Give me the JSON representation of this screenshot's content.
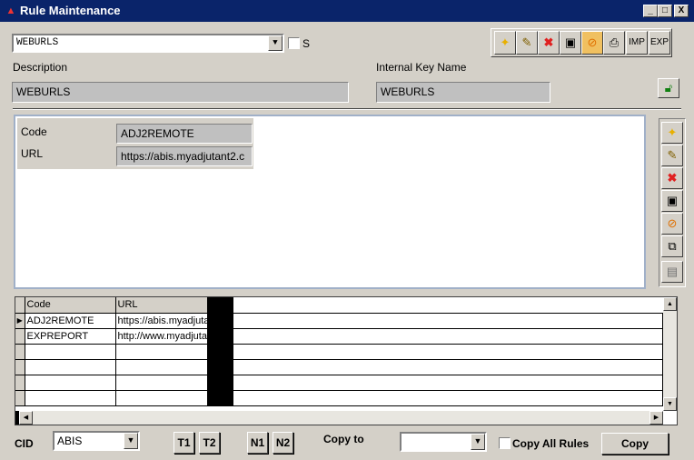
{
  "window": {
    "title": "Rule Maintenance",
    "minimize": "_",
    "maximize": "□",
    "close": "X"
  },
  "header": {
    "rule_select_value": "WEBURLS",
    "s_checkbox_label": "S",
    "description_label": "Description",
    "description_value": "WEBURLS",
    "internal_key_label": "Internal Key Name",
    "internal_key_value": "WEBURLS"
  },
  "toolbar": {
    "imp_label": "IMP",
    "exp_label": "EXP"
  },
  "detail": {
    "code_label": "Code",
    "code_value": "ADJ2REMOTE",
    "url_label": "URL",
    "url_value": "https://abis.myadjutant2.c"
  },
  "grid": {
    "columns": [
      "Code",
      "URL"
    ],
    "rows": [
      {
        "code": "ADJ2REMOTE",
        "url": "https://abis.myadjuta"
      },
      {
        "code": "EXPREPORT",
        "url": "http://www.myadjuta"
      },
      {
        "code": "",
        "url": ""
      },
      {
        "code": "",
        "url": ""
      },
      {
        "code": "",
        "url": ""
      },
      {
        "code": "",
        "url": ""
      }
    ],
    "current_row_marker": "▶"
  },
  "footer": {
    "cid_label": "CID",
    "cid_value": "ABIS",
    "t1_label": "T1",
    "t2_label": "T2",
    "n1_label": "N1",
    "n2_label": "N2",
    "copy_to_label": "Copy to",
    "copy_to_value": "",
    "copy_all_rules_label": "Copy All Rules",
    "copy_button_label": "Copy"
  },
  "colors": {
    "titlebar": "#0a246a",
    "window_bg": "#d4d0c8",
    "readonly_field": "#c0c0c0"
  }
}
